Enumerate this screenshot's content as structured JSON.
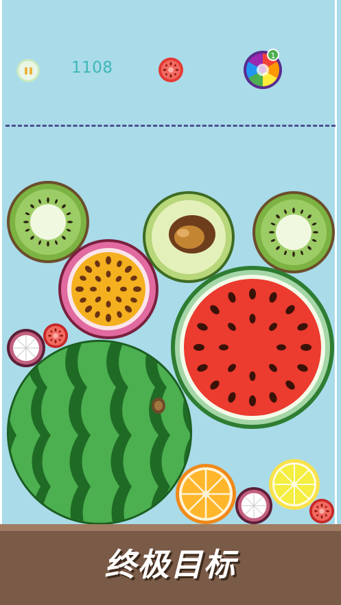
{
  "hud": {
    "score": "1108",
    "next_fruit_icon": "tomato-icon",
    "bomb_icon": "rainbow-bomb-icon",
    "bomb_count": "1",
    "pause_icon": "pause-icon"
  },
  "banner": {
    "text": "终极目标"
  },
  "colors": {
    "background": "#a9dbe9",
    "ground": "#7a5b48",
    "dead_line": "#4b4f8e",
    "score": "#3fb7b7"
  },
  "fruits": [
    "kiwi",
    "avocado",
    "kiwi",
    "passion-fruit",
    "watermelon-slice",
    "mangosteen",
    "tomato",
    "whole-watermelon",
    "orange-slice",
    "mangosteen",
    "lemon-slice",
    "tomato"
  ]
}
